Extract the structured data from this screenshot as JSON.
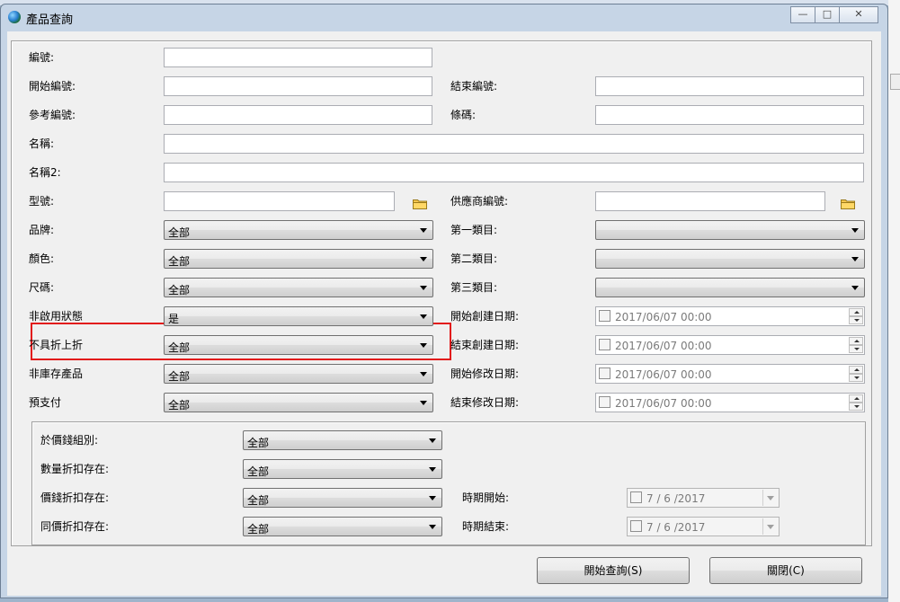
{
  "window": {
    "title": "產品查詢"
  },
  "labels": {
    "code": "編號:",
    "start_code": "開始編號:",
    "end_code": "結束編號:",
    "ref_code": "參考編號:",
    "barcode": "條碼:",
    "name": "名稱:",
    "name2": "名稱2:",
    "model": "型號:",
    "supplier_code": "供應商編號:",
    "brand": "品牌:",
    "category1": "第一類目:",
    "color": "顏色:",
    "category2": "第二類目:",
    "size": "尺碼:",
    "category3": "第三類目:",
    "inactive_status": "非啟用狀態",
    "create_start": "開始創建日期:",
    "no_discount": "不具折上折",
    "create_end": "結束創建日期:",
    "non_stock": "非庫存產品",
    "modify_start": "開始修改日期:",
    "prepaid": "預支付",
    "modify_end": "結束修改日期:",
    "price_group": "於價錢組別:",
    "qty_discount": "數量折扣存在:",
    "price_discount": "價錢折扣存在:",
    "period_start": "時期開始:",
    "same_price_discount": "同價折扣存在:",
    "period_end": "時期結束:"
  },
  "values": {
    "brand": "全部",
    "color": "全部",
    "size": "全部",
    "inactive_status": "是",
    "no_discount": "全部",
    "non_stock": "全部",
    "prepaid": "全部",
    "category1": "",
    "category2": "",
    "category3": "",
    "create_start": "2017/06/07 00:00",
    "create_end": "2017/06/07 00:00",
    "modify_start": "2017/06/07 00:00",
    "modify_end": "2017/06/07 00:00",
    "price_group": "全部",
    "qty_discount": "全部",
    "price_discount": "全部",
    "same_price_discount": "全部",
    "period_start": "7 / 6 /2017",
    "period_end": "7 / 6 /2017"
  },
  "buttons": {
    "search": "開始查詢(S)",
    "close": "關閉(C)"
  },
  "colors": {
    "highlight": "#e21b1b",
    "titlebar": "#c6d5e6"
  },
  "icons": {
    "app": "globe-icon",
    "browse": "folder-icon"
  }
}
